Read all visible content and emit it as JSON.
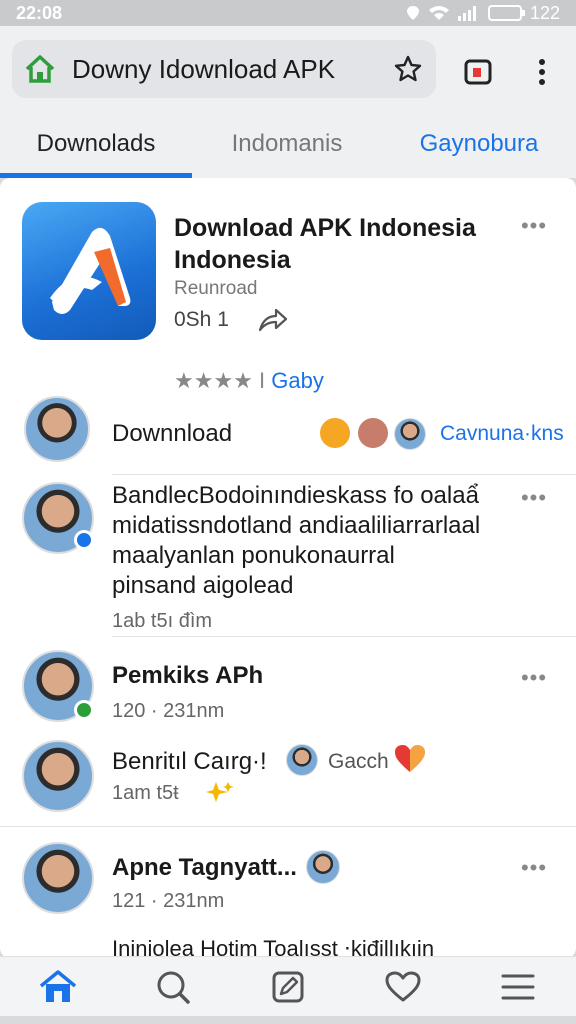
{
  "status": {
    "time": "22:08",
    "battery": "122"
  },
  "browser": {
    "url": "Downy Idownload APK"
  },
  "tabs": [
    {
      "label": "Downolads"
    },
    {
      "label": "Indomanis"
    },
    {
      "label": "Gaynobura"
    }
  ],
  "app": {
    "title": "Download APK Indonesia Indonesia",
    "subtitle": "Reunroad",
    "meta": "0Sh   1",
    "rating_stars": "★★★★",
    "rating_sep": "I",
    "rating_link": "Gaby"
  },
  "rows": {
    "download": {
      "label": "Downnload",
      "link": "Cavnuna·kns"
    },
    "post1": {
      "text_l1": "BandlecBodoinındieskass fo oalaẩ",
      "text_l2": "midatissndotland andiaaliliarrarlaal",
      "text_l3": "maalyanlan ponukonaurral",
      "text_l4": "pinsand aigolead",
      "time": "1ab  t5ı đìm"
    },
    "post2": {
      "title": "Pemkiks APh",
      "time": "120 · 231nm"
    },
    "post3": {
      "title": "Benritıl Caırg·!",
      "reaction_name": "Gacch",
      "time": "1am  t5ŧ"
    },
    "post4": {
      "title": "Apne Tagnyatt...",
      "time": "121 · 231nm"
    },
    "post5": {
      "title": "Injniolea Hotim Toalısst ⋅kiđillıkıin"
    }
  },
  "more_glyph": "•••",
  "colors": {
    "accent": "#1a73e8",
    "home_green": "#2e9e3a"
  }
}
